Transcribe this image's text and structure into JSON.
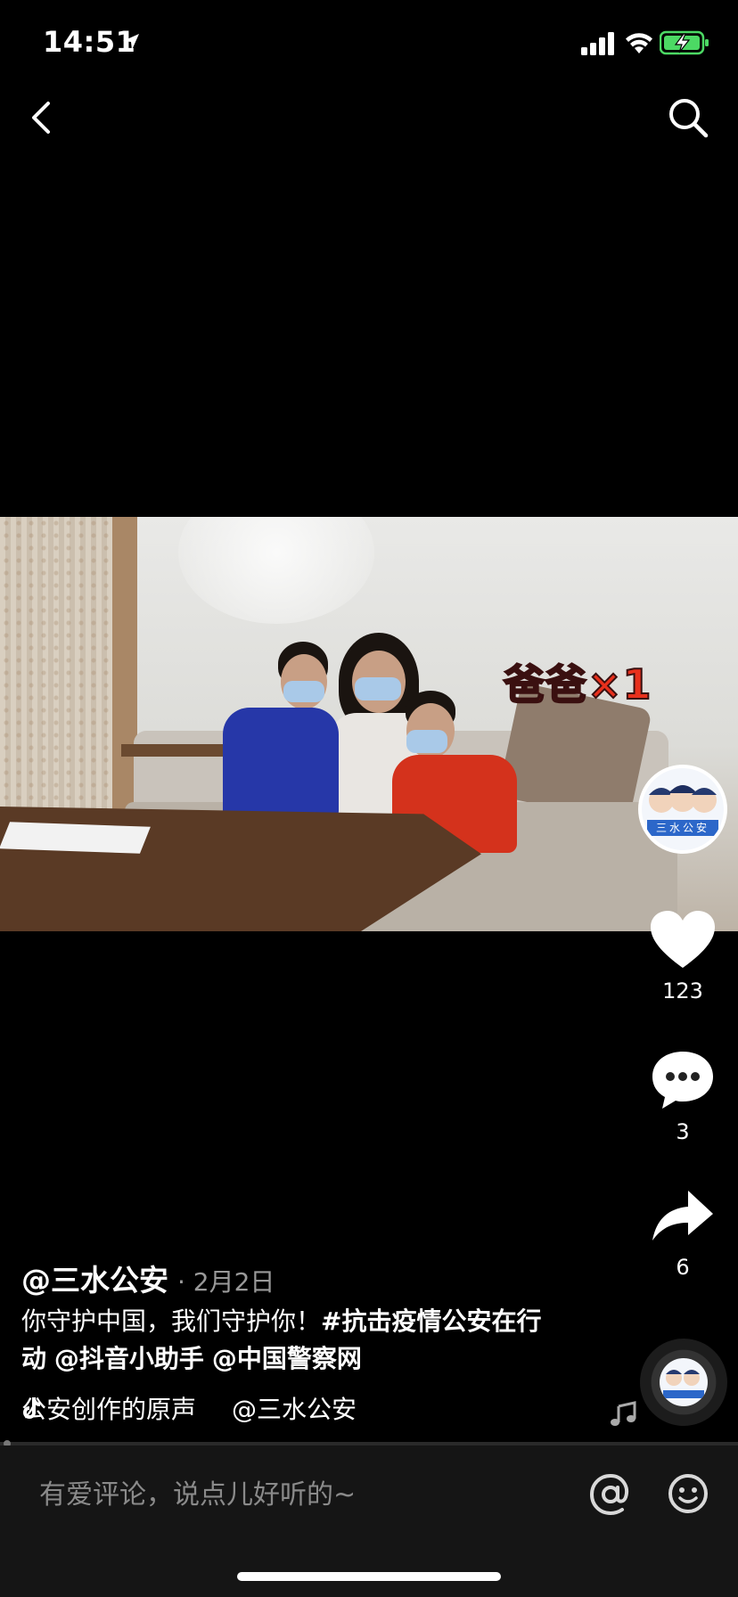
{
  "status_bar": {
    "time": "14:51",
    "icons": [
      "location-arrow-icon",
      "signal-bars-icon",
      "wifi-icon",
      "battery-charging-icon"
    ]
  },
  "nav": {
    "back_icon": "chevron-left-icon",
    "search_icon": "search-icon"
  },
  "video": {
    "overlay_text": "爸爸×1"
  },
  "rail": {
    "avatar_text": "三水公安",
    "like_count": "123",
    "comment_count": "3",
    "share_count": "6"
  },
  "post": {
    "author": "@三水公安",
    "date": "· 2月2日",
    "caption_plain": "你守护中国，我们守护你！",
    "caption_tag": "#抗击疫情公安在行动",
    "caption_mention1": "@抖音小助手",
    "caption_mention2": "@中国警察网",
    "music_text": "公安创作的原声",
    "music_author": "@三水公安"
  },
  "comment_bar": {
    "placeholder": "有爱评论，说点儿好听的~"
  },
  "colors": {
    "background": "#000000",
    "comment_bar": "#151515",
    "overlay_text": "#e8301c",
    "battery_green": "#4cd964"
  }
}
